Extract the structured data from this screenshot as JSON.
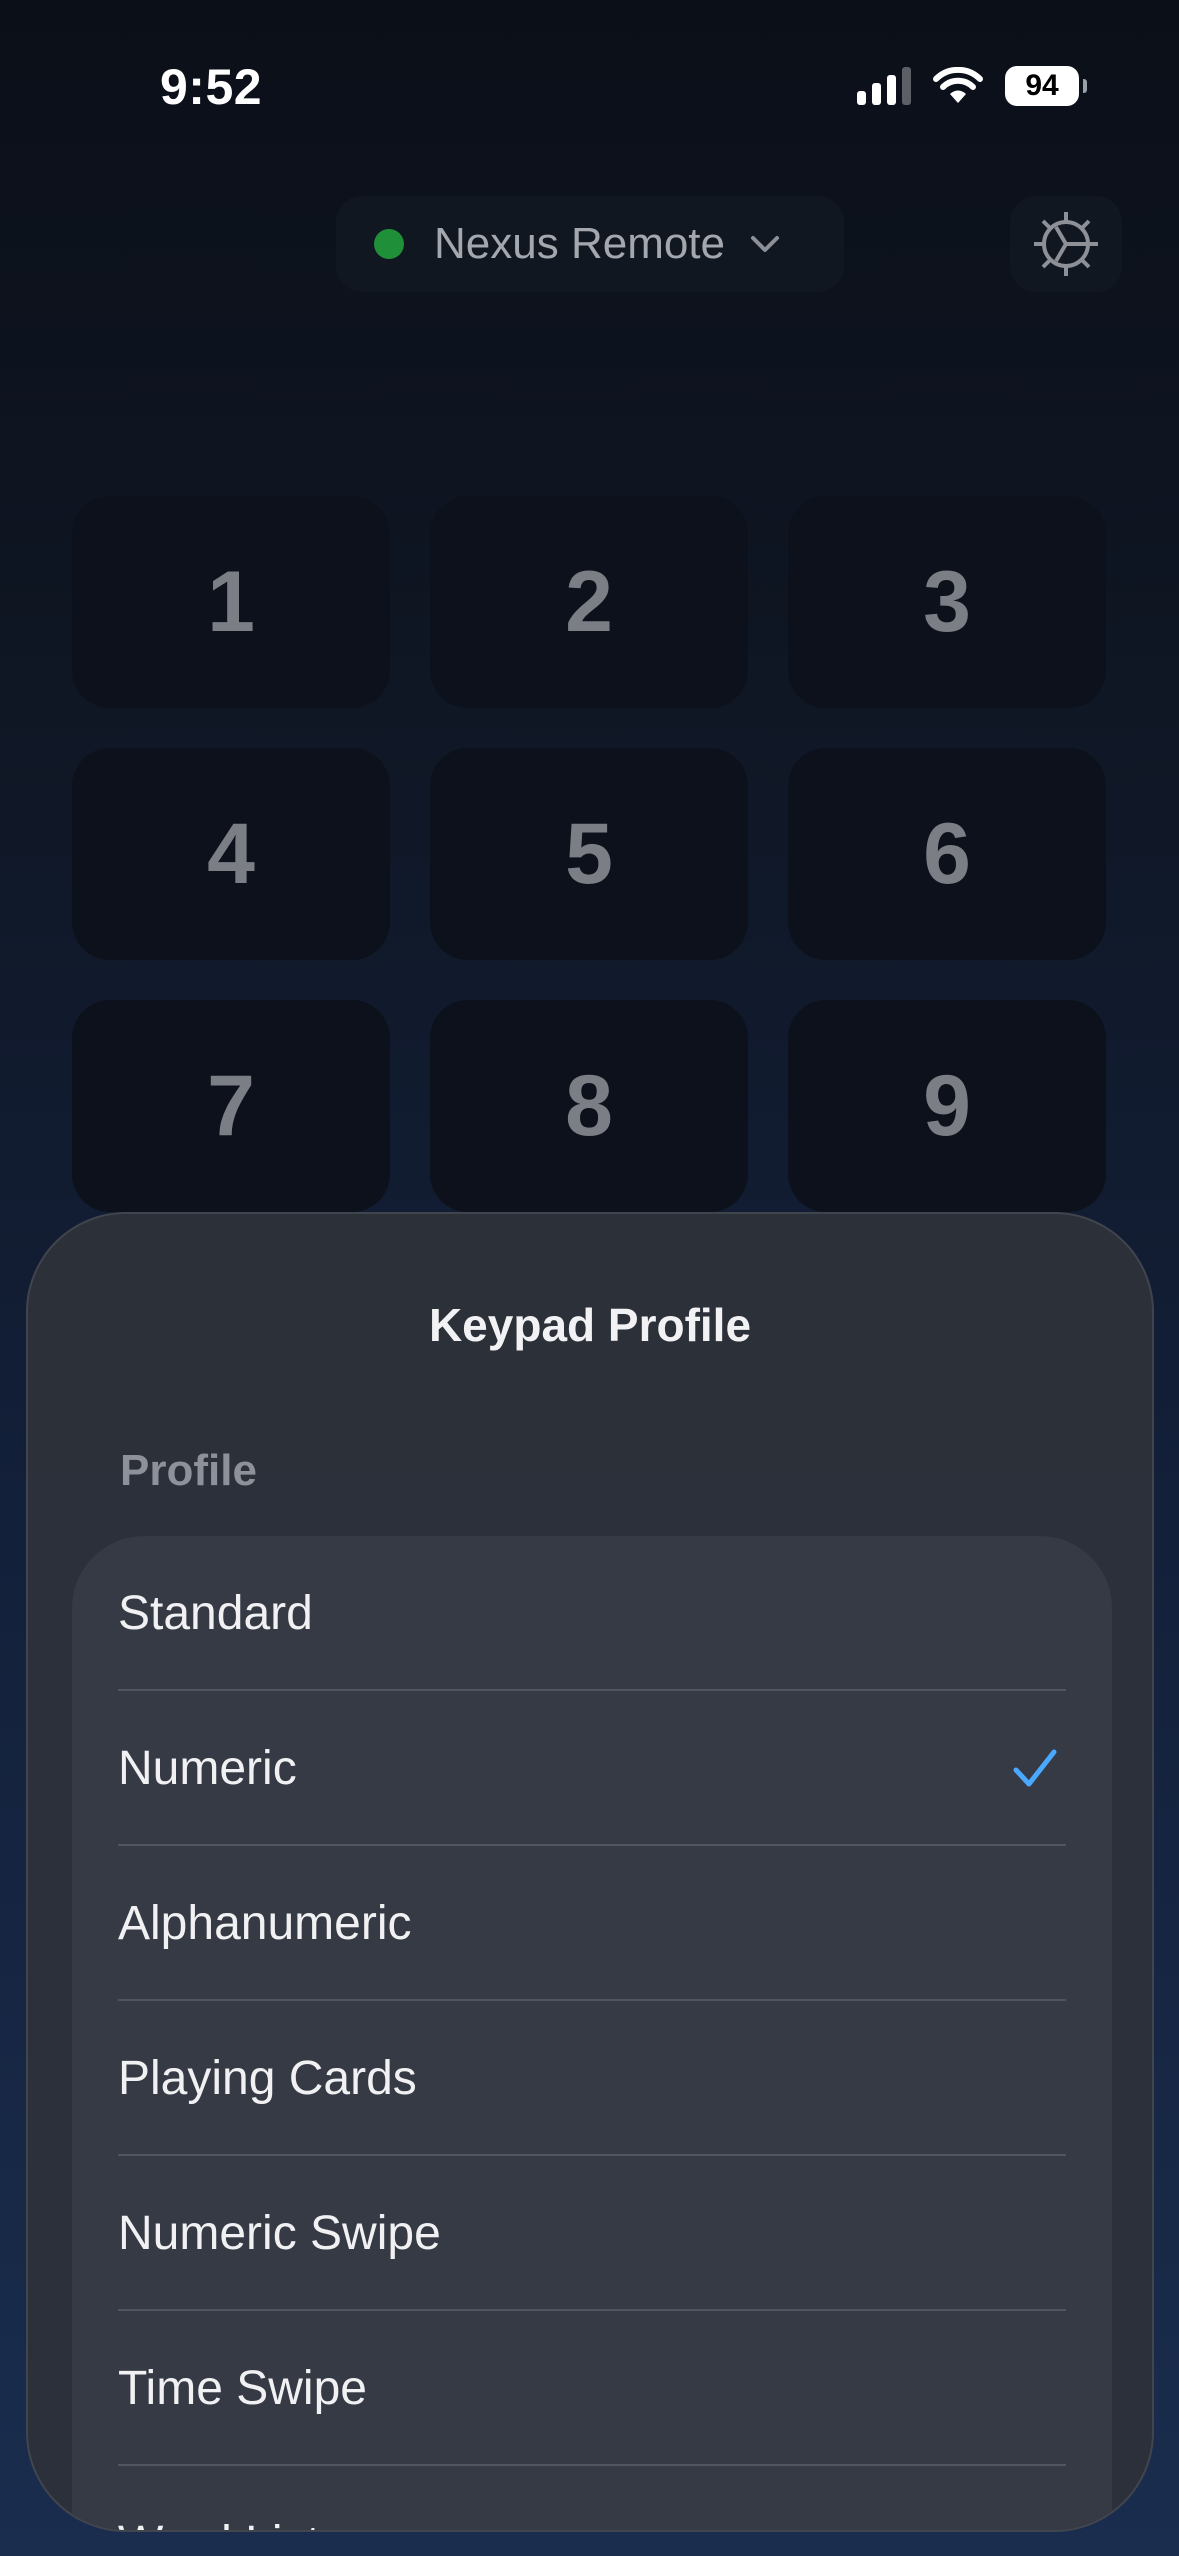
{
  "status_bar": {
    "time": "9:52",
    "battery": "94"
  },
  "header": {
    "device_name": "Nexus Remote",
    "status_color": "#1f8f3a"
  },
  "keypad": {
    "keys": [
      "1",
      "2",
      "3",
      "4",
      "5",
      "6",
      "7",
      "8",
      "9"
    ]
  },
  "sheet": {
    "title": "Keypad Profile",
    "section_label": "Profile",
    "options": [
      {
        "label": "Standard"
      },
      {
        "label": "Numeric",
        "selected": true
      },
      {
        "label": "Alphanumeric"
      },
      {
        "label": "Playing Cards"
      },
      {
        "label": "Numeric Swipe"
      },
      {
        "label": "Time Swipe"
      },
      {
        "label": "Word List"
      }
    ],
    "accent_color": "#4aa8ff"
  }
}
